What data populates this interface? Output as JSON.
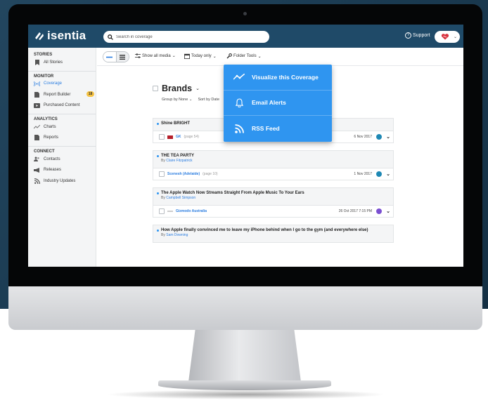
{
  "app": {
    "brand": "isentia",
    "search_placeholder": "Search in coverage",
    "support_label": "Support"
  },
  "sidebar": {
    "sections": [
      {
        "heading": "STORIES",
        "items": [
          {
            "label": "All Stories",
            "icon": "bookmark-icon"
          }
        ]
      },
      {
        "heading": "MONITOR",
        "items": [
          {
            "label": "Coverage",
            "icon": "broadcast-icon",
            "active": true
          },
          {
            "label": "Report Builder",
            "icon": "document-icon",
            "badge": "18"
          },
          {
            "label": "Purchased Content",
            "icon": "play-icon"
          }
        ]
      },
      {
        "heading": "ANALYTICS",
        "items": [
          {
            "label": "Charts",
            "icon": "line-chart-icon"
          },
          {
            "label": "Reports",
            "icon": "document-icon"
          }
        ]
      },
      {
        "heading": "CONNECT",
        "items": [
          {
            "label": "Contacts",
            "icon": "contacts-icon"
          },
          {
            "label": "Releases",
            "icon": "megaphone-icon"
          },
          {
            "label": "Industry Updates",
            "icon": "rss-icon"
          }
        ]
      }
    ]
  },
  "toolbar": {
    "show_media": "Show all media",
    "date_range": "Today only",
    "folder_tools": "Folder Tools"
  },
  "folder_menu": {
    "items": [
      {
        "label": "Visualize this Coverage",
        "icon": "trend-icon"
      },
      {
        "label": "Email Alerts",
        "icon": "bell-icon"
      },
      {
        "label": "RSS Feed",
        "icon": "rss-icon"
      }
    ]
  },
  "folder": {
    "title": "Brands",
    "group_by": "Group by None",
    "sort_by": "Sort by Date"
  },
  "stories": [
    {
      "title": "Shine BRIGHT",
      "source": "GK",
      "page": "(page 54)",
      "date": "6 Nov 2017",
      "source_color": "#1e88b4"
    },
    {
      "title": "THE TEA PARTY",
      "by_prefix": "By",
      "author": "Claire Fitzpatrick",
      "source": "Scenesh (Adelaide)",
      "page": "(page 10)",
      "date": "1 Nov 2017",
      "source_color": "#1e88b4"
    },
    {
      "title": "The Apple Watch Now Streams Straight From Apple Music To Your Ears",
      "by_prefix": "By",
      "author": "Campbell Simpson",
      "source": "Gizmodo Australia",
      "page": "",
      "date": "26 Oct 2017 7:15 PM",
      "source_color": "#7a4fd1"
    },
    {
      "title": "How Apple finally convinced me to leave my iPhone behind when I go to the gym (and everywhere else)",
      "by_prefix": "By",
      "author": "Sam Downing"
    }
  ]
}
